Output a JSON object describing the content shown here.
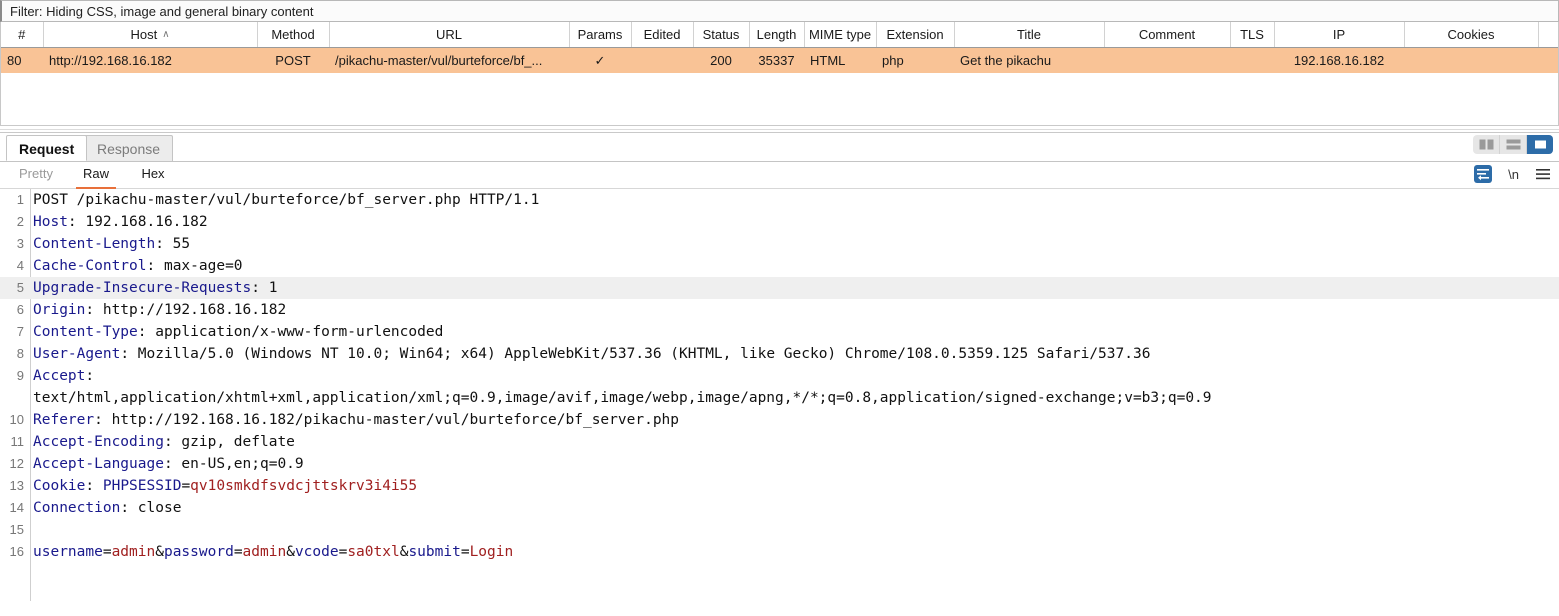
{
  "filter_bar": {
    "text": "Filter: Hiding CSS, image and general binary content"
  },
  "http_table": {
    "columns": [
      {
        "label": "#",
        "align": "center"
      },
      {
        "label": "Host",
        "align": "center",
        "sort": "asc"
      },
      {
        "label": "Method",
        "align": "center"
      },
      {
        "label": "URL",
        "align": "center"
      },
      {
        "label": "Params",
        "align": "center"
      },
      {
        "label": "Edited",
        "align": "center"
      },
      {
        "label": "Status",
        "align": "center"
      },
      {
        "label": "Length",
        "align": "center"
      },
      {
        "label": "MIME type",
        "align": "center"
      },
      {
        "label": "Extension",
        "align": "center"
      },
      {
        "label": "Title",
        "align": "center"
      },
      {
        "label": "Comment",
        "align": "center"
      },
      {
        "label": "TLS",
        "align": "center"
      },
      {
        "label": "IP",
        "align": "center"
      },
      {
        "label": "Cookies",
        "align": "center"
      },
      {
        "label": "",
        "align": "center"
      }
    ],
    "rows": [
      {
        "number": "80",
        "host": "http://192.168.16.182",
        "method": "POST",
        "url": "/pikachu-master/vul/burteforce/bf_...",
        "params": "✓",
        "edited": "",
        "status": "200",
        "length": "35337",
        "mime_type": "HTML",
        "extension": "php",
        "title": "Get the pikachu",
        "comment": "",
        "tls": "",
        "ip": "192.168.16.182",
        "cookies": "",
        "selected": true
      }
    ]
  },
  "message_tabs": {
    "request_label": "Request",
    "response_label": "Response",
    "active": "Request",
    "layout_buttons": [
      {
        "name": "side-by-side-layout",
        "selected": false
      },
      {
        "name": "stacked-layout",
        "selected": false
      },
      {
        "name": "single-pane-layout",
        "selected": true
      }
    ]
  },
  "view_tabs": {
    "items": [
      {
        "label": "Pretty",
        "active": false
      },
      {
        "label": "Raw",
        "active": true
      },
      {
        "label": "Hex",
        "active": false
      }
    ],
    "tools": [
      {
        "name": "word-wrap-icon",
        "selected": true
      },
      {
        "name": "newline-icon",
        "glyph": "\\n",
        "selected": false
      },
      {
        "name": "hamburger-menu-icon",
        "selected": false
      }
    ]
  },
  "raw_request": {
    "lines": [
      {
        "number": "1",
        "highlight": false,
        "spans": [
          {
            "t": "POST /pikachu-master/vul/burteforce/bf_server.php HTTP/1.1",
            "c": "plain"
          }
        ]
      },
      {
        "number": "2",
        "highlight": false,
        "spans": [
          {
            "t": "Host",
            "c": "hdr"
          },
          {
            "t": ": 192.168.16.182",
            "c": "plain"
          }
        ]
      },
      {
        "number": "3",
        "highlight": false,
        "spans": [
          {
            "t": "Content-Length",
            "c": "hdr"
          },
          {
            "t": ": 55",
            "c": "plain"
          }
        ]
      },
      {
        "number": "4",
        "highlight": false,
        "spans": [
          {
            "t": "Cache-Control",
            "c": "hdr"
          },
          {
            "t": ": max-age=0",
            "c": "plain"
          }
        ]
      },
      {
        "number": "5",
        "highlight": true,
        "spans": [
          {
            "t": "Upgrade-Insecure-Requests",
            "c": "hdr"
          },
          {
            "t": ": 1",
            "c": "plain"
          }
        ]
      },
      {
        "number": "6",
        "highlight": false,
        "spans": [
          {
            "t": "Origin",
            "c": "hdr"
          },
          {
            "t": ": http://192.168.16.182",
            "c": "plain"
          }
        ]
      },
      {
        "number": "7",
        "highlight": false,
        "spans": [
          {
            "t": "Content-Type",
            "c": "hdr"
          },
          {
            "t": ": application/x-www-form-urlencoded",
            "c": "plain"
          }
        ]
      },
      {
        "number": "8",
        "highlight": false,
        "spans": [
          {
            "t": "User-Agent",
            "c": "hdr"
          },
          {
            "t": ": Mozilla/5.0 (Windows NT 10.0; Win64; x64) AppleWebKit/537.36 (KHTML, like Gecko) Chrome/108.0.5359.125 Safari/537.36",
            "c": "plain"
          }
        ]
      },
      {
        "number": "9",
        "highlight": false,
        "spans": [
          {
            "t": "Accept",
            "c": "hdr"
          },
          {
            "t": ":",
            "c": "plain"
          }
        ]
      },
      {
        "number": "",
        "highlight": false,
        "spans": [
          {
            "t": "text/html,application/xhtml+xml,application/xml;q=0.9,image/avif,image/webp,image/apng,*/*;q=0.8,application/signed-exchange;v=b3;q=0.9",
            "c": "plain"
          }
        ]
      },
      {
        "number": "10",
        "highlight": false,
        "spans": [
          {
            "t": "Referer",
            "c": "hdr"
          },
          {
            "t": ": http://192.168.16.182/pikachu-master/vul/burteforce/bf_server.php",
            "c": "plain"
          }
        ]
      },
      {
        "number": "11",
        "highlight": false,
        "spans": [
          {
            "t": "Accept-Encoding",
            "c": "hdr"
          },
          {
            "t": ": gzip, deflate",
            "c": "plain"
          }
        ]
      },
      {
        "number": "12",
        "highlight": false,
        "spans": [
          {
            "t": "Accept-Language",
            "c": "hdr"
          },
          {
            "t": ": en-US,en;q=0.9",
            "c": "plain"
          }
        ]
      },
      {
        "number": "13",
        "highlight": false,
        "spans": [
          {
            "t": "Cookie",
            "c": "hdr"
          },
          {
            "t": ": ",
            "c": "plain"
          },
          {
            "t": "PHPSESSID",
            "c": "blue"
          },
          {
            "t": "=",
            "c": "plain"
          },
          {
            "t": "qv10smkdfsvdcjttskrv3i4i55",
            "c": "red"
          }
        ]
      },
      {
        "number": "14",
        "highlight": false,
        "spans": [
          {
            "t": "Connection",
            "c": "hdr"
          },
          {
            "t": ": close",
            "c": "plain"
          }
        ]
      },
      {
        "number": "15",
        "highlight": false,
        "spans": [
          {
            "t": "",
            "c": "plain"
          }
        ]
      },
      {
        "number": "16",
        "highlight": false,
        "spans": [
          {
            "t": "username",
            "c": "blue"
          },
          {
            "t": "=",
            "c": "plain"
          },
          {
            "t": "admin",
            "c": "red"
          },
          {
            "t": "&",
            "c": "plain"
          },
          {
            "t": "password",
            "c": "blue"
          },
          {
            "t": "=",
            "c": "plain"
          },
          {
            "t": "admin",
            "c": "red"
          },
          {
            "t": "&",
            "c": "plain"
          },
          {
            "t": "vcode",
            "c": "blue"
          },
          {
            "t": "=",
            "c": "plain"
          },
          {
            "t": "sa0txl",
            "c": "red"
          },
          {
            "t": "&",
            "c": "plain"
          },
          {
            "t": "submit",
            "c": "blue"
          },
          {
            "t": "=",
            "c": "plain"
          },
          {
            "t": "Login",
            "c": "red"
          }
        ]
      }
    ]
  },
  "colors": {
    "selected_row": "#f9c396",
    "header_name": "#19198c",
    "param_value": "#a02020",
    "accent": "#e8703a",
    "layout_selected": "#2d6ca8"
  }
}
